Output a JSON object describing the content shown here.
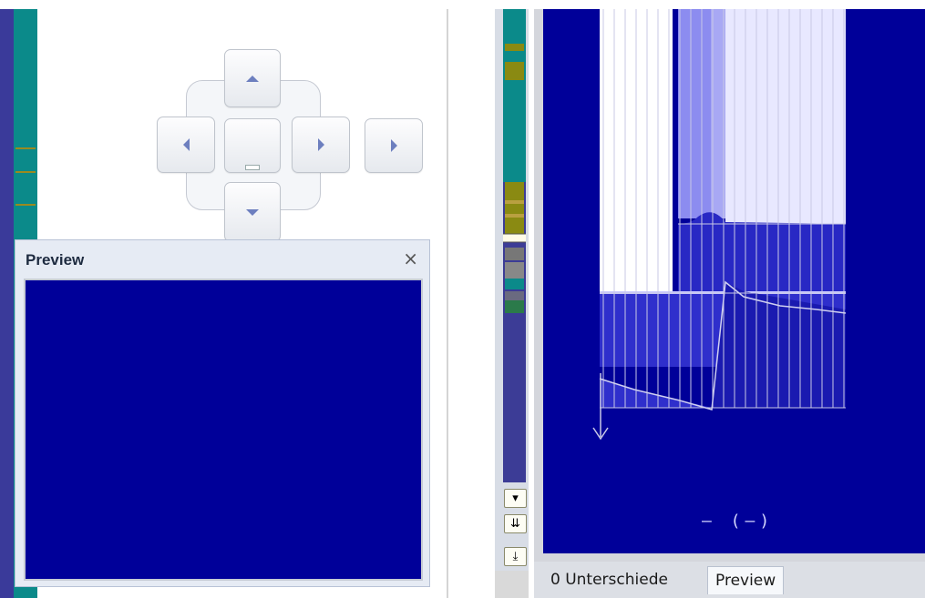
{
  "preview_panel": {
    "title": "Preview",
    "close_glyph": "×"
  },
  "dock_navigator": {
    "buttons": [
      "dock-up",
      "dock-left",
      "dock-center",
      "dock-right",
      "dock-down",
      "dock-right-outer"
    ]
  },
  "diff_view": {
    "center_label": "– (–)"
  },
  "overview": {
    "buttons": [
      "▾",
      "⇊",
      "⤓"
    ]
  },
  "tabs": [
    {
      "label": "0 Unterschiede"
    },
    {
      "label": "Preview"
    }
  ],
  "colors": {
    "canvas": "#000099",
    "teal": "#0b8a8a",
    "olive": "#8a8a12",
    "highlight": "#9a9af0"
  }
}
